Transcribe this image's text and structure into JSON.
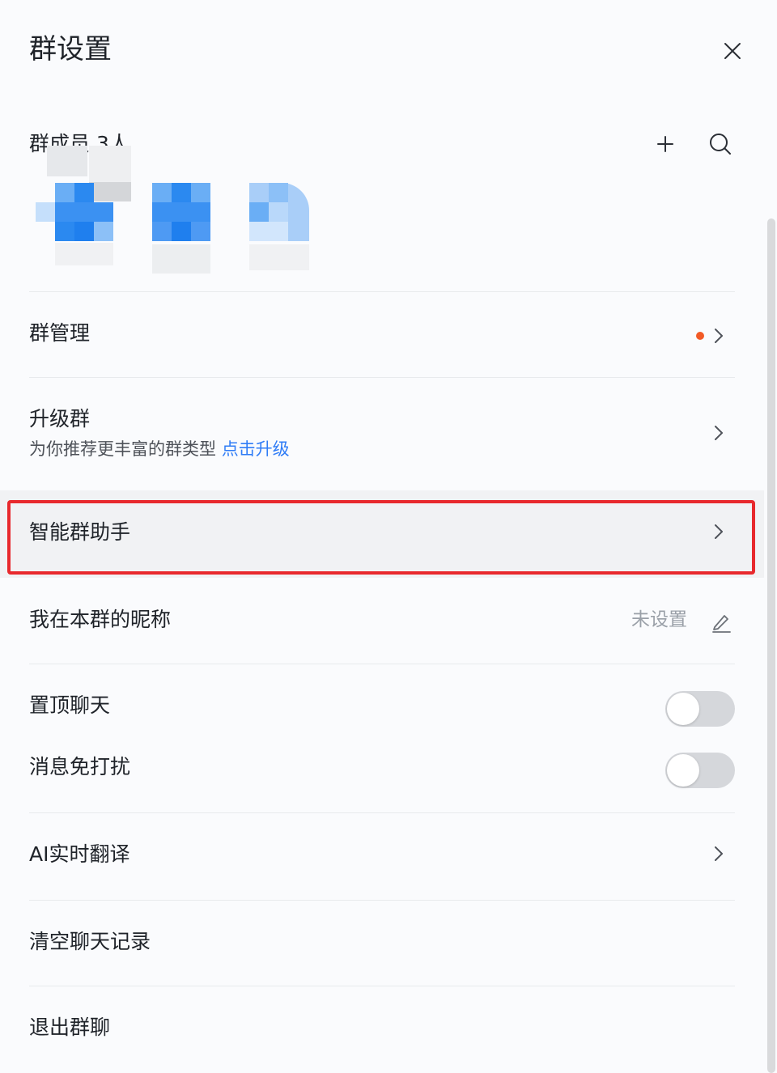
{
  "header": {
    "title": "群设置"
  },
  "members": {
    "label": "群成员 3人"
  },
  "menu": {
    "group_manage": "群管理",
    "upgrade": {
      "label": "升级群",
      "desc": "为你推荐更丰富的群类型",
      "link": "点击升级"
    },
    "assistant": "智能群助手",
    "nickname": {
      "label": "我在本群的昵称",
      "value": "未设置"
    },
    "pin_chat": {
      "label": "置顶聊天",
      "on": false
    },
    "mute": {
      "label": "消息免打扰",
      "on": false
    },
    "ai_translate": "AI实时翻译",
    "clear_history": "清空聊天记录",
    "exit_group": "退出群聊"
  },
  "colors": {
    "accent": "#2f7cf6",
    "notice_dot": "#f25a26",
    "highlight_border": "#e8292d",
    "toggle_off": "#d5d7db"
  },
  "icons": [
    "close-icon",
    "plus-icon",
    "search-icon",
    "chevron-right-icon",
    "edit-pencil-icon"
  ]
}
